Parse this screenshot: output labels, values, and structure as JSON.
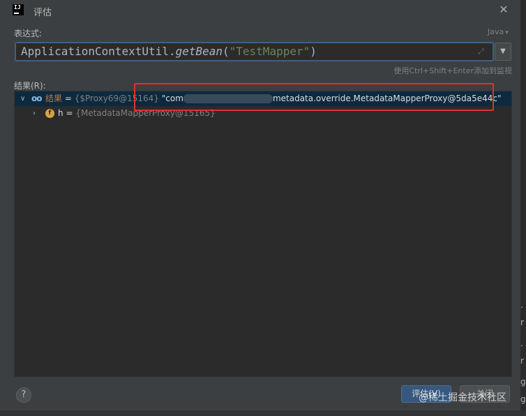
{
  "window": {
    "title": "评估",
    "logo_text": "IJ",
    "close_glyph": "✕"
  },
  "expression": {
    "label": "表达式:",
    "language": "Java",
    "code_prefix": "ApplicationContextUtil.",
    "code_method": "getBean",
    "code_open": "(",
    "code_string": "\"TestMapper\"",
    "code_close": ")",
    "expand_icon": "expand-icon",
    "hint": "使用Ctrl+Shift+Enter添加到监视"
  },
  "results": {
    "label": "结果(R):",
    "rows": [
      {
        "name": "结果",
        "eq": "=",
        "type": "{$Proxy69@15164}",
        "value_start": "\"com",
        "value_end": "metadata.override.MetadataMapperProxy@5da5e44c\""
      },
      {
        "badge": "f",
        "name": "h",
        "eq": "=",
        "type": "{MetadataMapperProxy@15165}"
      }
    ]
  },
  "buttons": {
    "help": "?",
    "evaluate": "评估(V)",
    "close": "关闭"
  },
  "watermark": "@稀土掘金技术社区",
  "colors": {
    "background": "#3c3f41",
    "editor": "#2b2b2b",
    "selection": "#0d293e",
    "highlight": "#e03030",
    "accent": "#365880"
  }
}
